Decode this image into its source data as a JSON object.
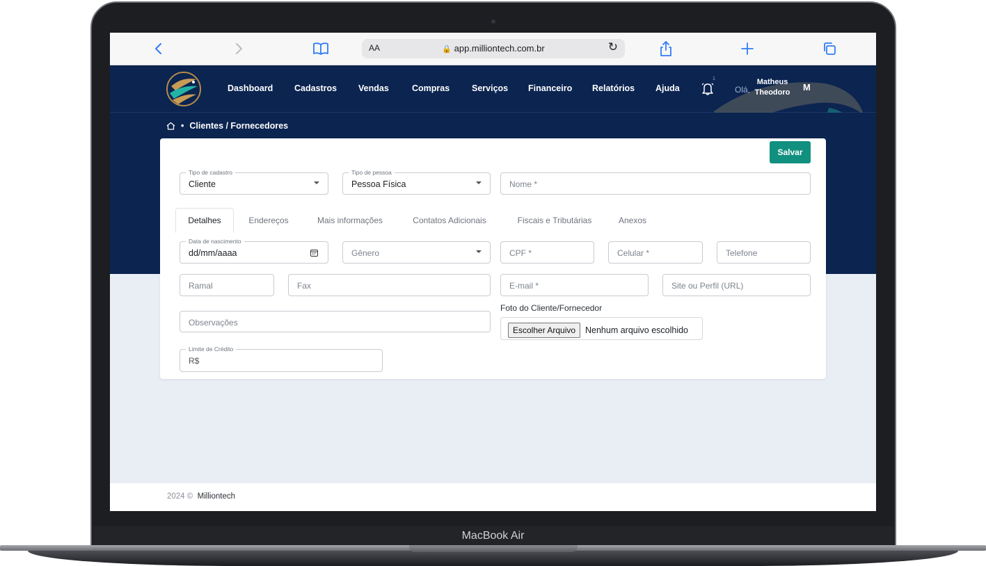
{
  "browser": {
    "text_size_label": "AA",
    "url": "app.milliontech.com.br"
  },
  "nav": {
    "items": [
      "Dashboard",
      "Cadastros",
      "Vendas",
      "Compras",
      "Serviços",
      "Financeiro",
      "Relatórios",
      "Ajuda"
    ],
    "notification_count": "1",
    "greeting": "Olá,",
    "user_first": "Matheus",
    "user_last": "Theodoro",
    "avatar_initial": "M"
  },
  "breadcrumb": {
    "separator": "•",
    "current": "Clientes / Fornecedores"
  },
  "form": {
    "save_label": "Salvar",
    "tipo_cadastro": {
      "legend": "Tipo de cadastro",
      "value": "Cliente"
    },
    "tipo_pessoa": {
      "legend": "Tipo de pessoa",
      "value": "Pessoa Física"
    },
    "nome_placeholder": "Nome *",
    "tabs": [
      "Detalhes",
      "Endereços",
      "Mais informações",
      "Contatos Adicionais",
      "Fiscais e Tributárias",
      "Anexos"
    ],
    "active_tab": "Detalhes",
    "data_nascimento": {
      "legend": "Data de nascimento",
      "value": "dd/mm/aaaa"
    },
    "genero_placeholder": "Gênero",
    "cpf_placeholder": "CPF *",
    "celular_placeholder": "Celular *",
    "telefone_placeholder": "Telefone",
    "ramal_placeholder": "Ramal",
    "fax_placeholder": "Fax",
    "email_placeholder": "E-mail *",
    "site_placeholder": "Site ou Perfil (URL)",
    "observacoes_placeholder": "Observações",
    "foto_label": "Foto do Cliente/Fornecedor",
    "file_button": "Escolher Arquivo",
    "file_none": "Nenhum arquivo escolhido",
    "limite": {
      "legend": "Limite de Crédito",
      "value": "R$"
    }
  },
  "footer": {
    "year": "2024 ©",
    "brand": "Milliontech"
  },
  "device": {
    "label": "MacBook Air"
  },
  "colors": {
    "nav_bg": "#0b2450",
    "accent_green": "#11907f",
    "browser_blue": "#2f7cf6"
  }
}
